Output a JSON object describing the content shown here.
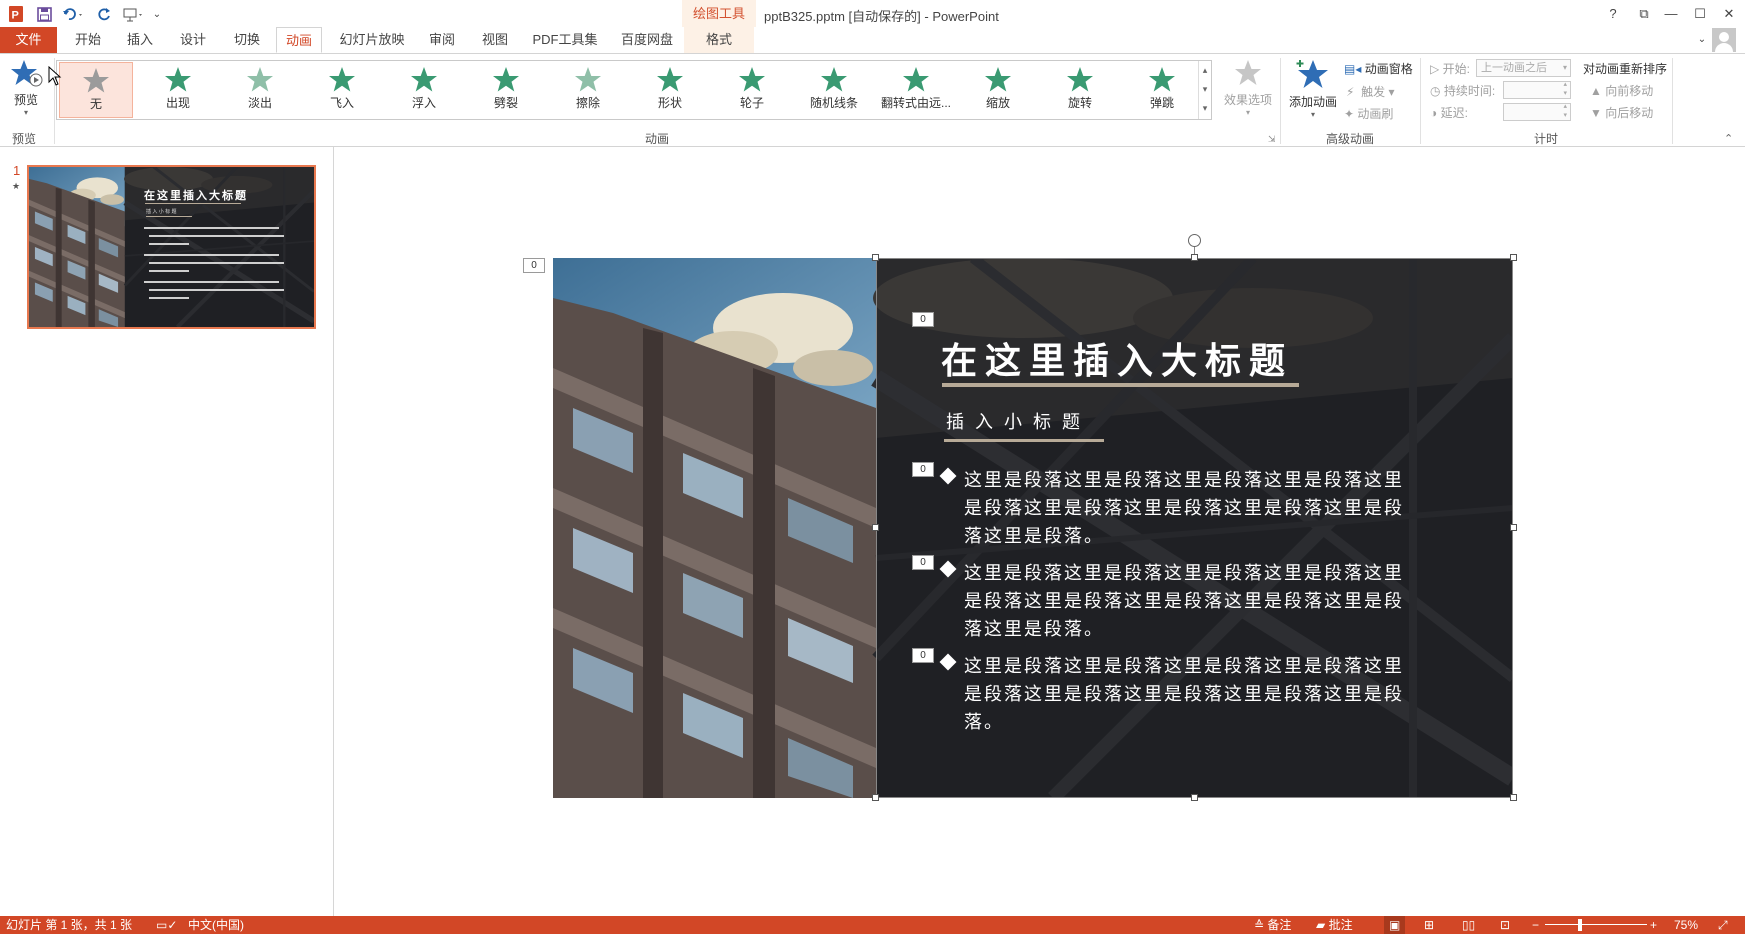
{
  "window": {
    "title": "pptB325.pptm [自动保存的] - PowerPoint",
    "context_tool": "绘图工具",
    "help": "?",
    "restore": "⧉",
    "minimize": "—",
    "maximize": "☐",
    "close": "✕"
  },
  "tabs": {
    "file": "文件",
    "home": "开始",
    "insert": "插入",
    "design": "设计",
    "transitions": "切换",
    "animations": "动画",
    "slideshow": "幻灯片放映",
    "review": "审阅",
    "view": "视图",
    "pdf": "PDF工具集",
    "baidu": "百度网盘",
    "format": "格式"
  },
  "ribbon": {
    "preview": {
      "label": "预览",
      "group": "预览"
    },
    "animation_group": "动画",
    "gallery": [
      {
        "label": "无",
        "color": "#9b9b9b"
      },
      {
        "label": "出现",
        "color": "#3a9a72"
      },
      {
        "label": "淡出",
        "color": "#8fbfa8"
      },
      {
        "label": "飞入",
        "color": "#3a9a72"
      },
      {
        "label": "浮入",
        "color": "#3a9a72"
      },
      {
        "label": "劈裂",
        "color": "#3a9a72"
      },
      {
        "label": "擦除",
        "color": "#8fbfa8"
      },
      {
        "label": "形状",
        "color": "#3a9a72"
      },
      {
        "label": "轮子",
        "color": "#3a9a72"
      },
      {
        "label": "随机线条",
        "color": "#3a9a72"
      },
      {
        "label": "翻转式由远...",
        "color": "#3a9a72"
      },
      {
        "label": "缩放",
        "color": "#3a9a72"
      },
      {
        "label": "旋转",
        "color": "#3a9a72"
      },
      {
        "label": "弹跳",
        "color": "#3a9a72"
      }
    ],
    "effect_options": "效果选项",
    "add_animation": "添加动画",
    "animation_pane": "动画窗格",
    "trigger": "触发",
    "animation_painter": "动画刷",
    "advanced_group": "高级动画",
    "start_label": "开始:",
    "start_value": "上一动画之后",
    "duration_label": "持续时间:",
    "delay_label": "延迟:",
    "timing_group": "计时",
    "reorder": "对动画重新排序",
    "move_earlier": "向前移动",
    "move_later": "向后移动"
  },
  "thumbnail": {
    "number": "1",
    "star": "★",
    "title": "在这里插入大标题",
    "subtitle": "插 入 小 标 题"
  },
  "slide": {
    "title": "在这里插入大标题",
    "subtitle": "插入小标题",
    "paragraphs": [
      "这里是段落这里是段落这里是段落这里是段落这里是段落这里是段落这里是段落这里是段落这里是段落这里是段落。",
      "这里是段落这里是段落这里是段落这里是段落这里是段落这里是段落这里是段落这里是段落这里是段落这里是段落。",
      "这里是段落这里是段落这里是段落这里是段落这里是段落这里是段落这里是段落这里是段落这里是段落。"
    ],
    "anim_tags": [
      "0",
      "0",
      "0",
      "0",
      "0"
    ]
  },
  "status": {
    "slide_info": "幻灯片 第 1 张，共 1 张",
    "language": "中文(中国)",
    "notes": "备注",
    "comments": "批注",
    "zoom": "75%",
    "zoom_minus": "−",
    "zoom_plus": "+"
  },
  "colors": {
    "accent": "#d24726",
    "gallery_green": "#3a9a72",
    "selected_bg": "#fce4dc"
  }
}
